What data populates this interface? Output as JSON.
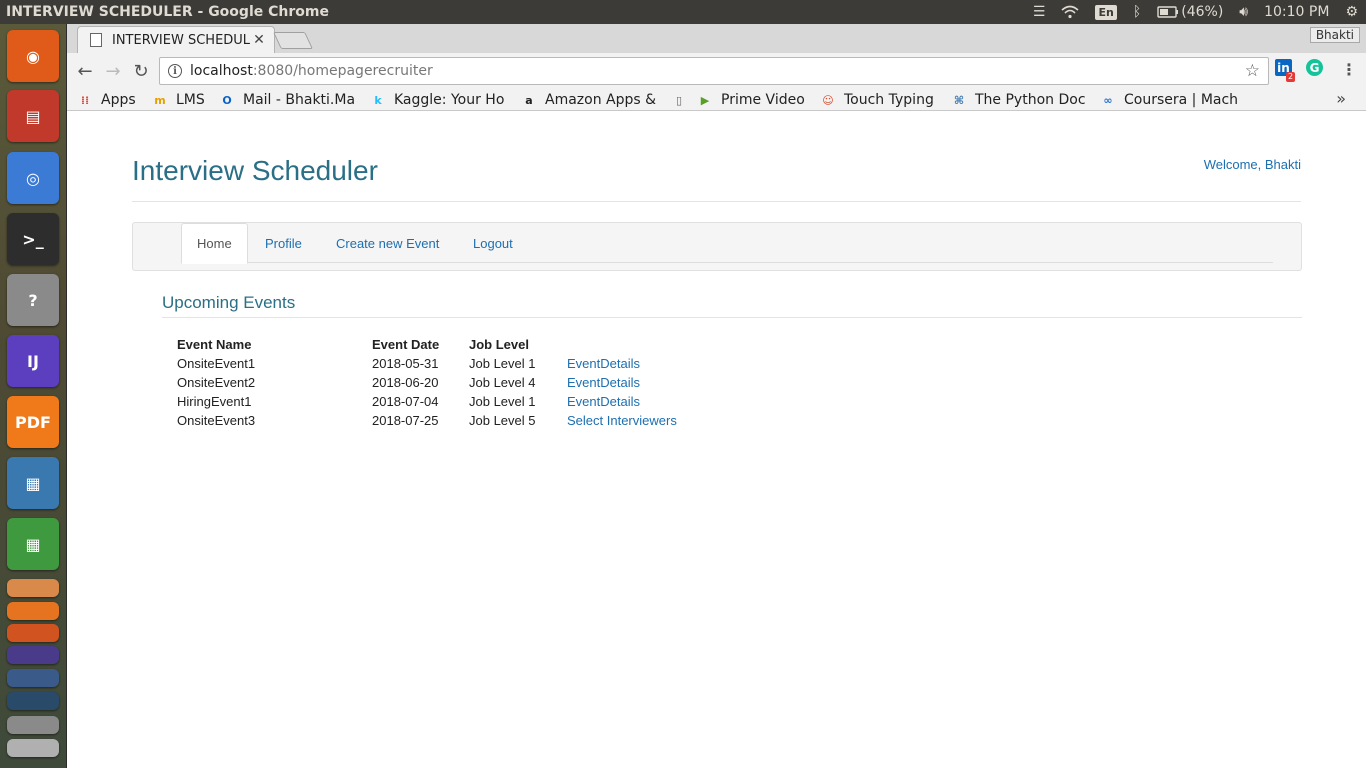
{
  "os_panel": {
    "window_title": "INTERVIEW SCHEDULER - Google Chrome",
    "keyboard_layout": "En",
    "battery": "(46%)",
    "clock": "10:10 PM",
    "icons": [
      "menu-icon",
      "wifi-icon",
      "keyboard-icon",
      "bluetooth-icon",
      "battery-icon",
      "volume-icon",
      "settings-icon"
    ]
  },
  "launcher": {
    "apps": [
      {
        "name": "Ubuntu Dash",
        "color": "#e05a1a",
        "glyph": "◉"
      },
      {
        "name": "Files",
        "color": "#c0392b",
        "glyph": "▤"
      },
      {
        "name": "Google Chrome",
        "color": "#3b7bd6",
        "glyph": "◎"
      },
      {
        "name": "Terminal",
        "color": "#2d2d2d",
        "glyph": ">_"
      },
      {
        "name": "Help",
        "color": "#8a8a8a",
        "glyph": "?"
      },
      {
        "name": "IntelliJ IDEA",
        "color": "#5b3fbf",
        "glyph": "IJ"
      },
      {
        "name": "Foxit PDF",
        "color": "#f07a1a",
        "glyph": "PDF"
      },
      {
        "name": "LibreOffice Impress",
        "color": "#3a78b0",
        "glyph": "▦"
      },
      {
        "name": "LibreOffice Calc",
        "color": "#3f9a3f",
        "glyph": "▦"
      }
    ]
  },
  "browser": {
    "tab_title": "INTERVIEW SCHEDULER",
    "profile_name": "Bhakti",
    "url_host": "localhost",
    "url_rest": ":8080/homepagerecruiter",
    "extensions": [
      {
        "label": "in",
        "badge": "2",
        "color": "#0a66c2"
      },
      {
        "label": "G",
        "color": "#15c39a"
      }
    ],
    "bookmarks": [
      {
        "label": "Apps",
        "icon": "apps-grid-icon",
        "color": "#e04b3a"
      },
      {
        "label": "LMS",
        "icon": "lms-icon",
        "color": "#e5a100"
      },
      {
        "label": "Mail - Bhakti.Ma",
        "icon": "outlook-icon",
        "color": "#0a64c8"
      },
      {
        "label": "Kaggle: Your Ho",
        "icon": "kaggle-icon",
        "color": "#20beff"
      },
      {
        "label": "Amazon Apps &",
        "icon": "amazon-icon",
        "color": "#222222"
      },
      {
        "label": "",
        "icon": "page-icon",
        "color": "#666666"
      },
      {
        "label": "Prime Video",
        "icon": "prime-video-icon",
        "color": "#5a9e2a"
      },
      {
        "label": "Touch Typing",
        "icon": "touch-typing-icon",
        "color": "#d84a2a"
      },
      {
        "label": "The Python Doc",
        "icon": "python-icon",
        "color": "#3d78b0"
      },
      {
        "label": "Coursera | Mach",
        "icon": "coursera-icon",
        "color": "#2a73cc"
      }
    ]
  },
  "app": {
    "title": "Interview Scheduler",
    "welcome": "Welcome, Bhakti",
    "nav": [
      {
        "label": "Home",
        "active": true
      },
      {
        "label": "Profile",
        "active": false
      },
      {
        "label": "Create new Event",
        "active": false
      },
      {
        "label": "Logout",
        "active": false
      }
    ],
    "section_title": "Upcoming Events",
    "table": {
      "headers": [
        "Event Name",
        "Event Date",
        "Job Level",
        ""
      ],
      "rows": [
        {
          "name": "OnsiteEvent1",
          "date": "2018-05-31",
          "level": "Job Level 1",
          "action": "EventDetails"
        },
        {
          "name": "OnsiteEvent2",
          "date": "2018-06-20",
          "level": "Job Level 4",
          "action": "EventDetails"
        },
        {
          "name": "HiringEvent1",
          "date": "2018-07-04",
          "level": "Job Level 1",
          "action": "EventDetails"
        },
        {
          "name": "OnsiteEvent3",
          "date": "2018-07-25",
          "level": "Job Level 5",
          "action": "Select Interviewers"
        }
      ]
    }
  }
}
